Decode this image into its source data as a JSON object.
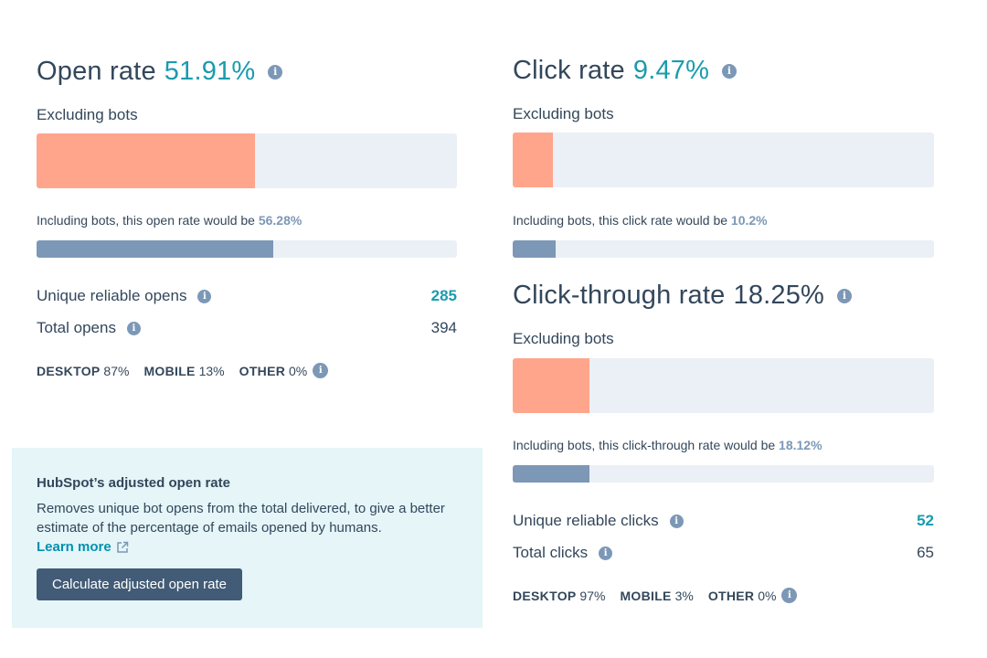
{
  "open_rate": {
    "title": "Open rate",
    "value": "51.91%",
    "fill_percent": 51.91,
    "excluding_label": "Excluding bots",
    "including_text": "Including bots, this open rate would be ",
    "including_value": "56.28%",
    "including_fill_percent": 56.28,
    "stats": [
      {
        "label": "Unique reliable opens",
        "value": "285",
        "accent": true
      },
      {
        "label": "Total opens",
        "value": "394",
        "accent": false
      }
    ],
    "devices": [
      {
        "name": "DESKTOP",
        "value": "87%"
      },
      {
        "name": "MOBILE",
        "value": "13%"
      },
      {
        "name": "OTHER",
        "value": "0%"
      }
    ]
  },
  "click_rate": {
    "title": "Click rate",
    "value": "9.47%",
    "fill_percent": 9.47,
    "excluding_label": "Excluding bots",
    "including_text": "Including bots, this click rate would be ",
    "including_value": "10.2%",
    "including_fill_percent": 10.2
  },
  "ctr": {
    "title": "Click-through rate",
    "value": "18.25%",
    "fill_percent": 18.25,
    "excluding_label": "Excluding bots",
    "including_text": "Including bots, this click-through rate would be ",
    "including_value": "18.12%",
    "including_fill_percent": 18.12,
    "stats": [
      {
        "label": "Unique reliable clicks",
        "value": "52",
        "accent": true
      },
      {
        "label": "Total clicks",
        "value": "65",
        "accent": false
      }
    ],
    "devices": [
      {
        "name": "DESKTOP",
        "value": "97%"
      },
      {
        "name": "MOBILE",
        "value": "3%"
      },
      {
        "name": "OTHER",
        "value": "0%"
      }
    ]
  },
  "callout": {
    "title": "HubSpot’s adjusted open rate",
    "body": "Removes unique bot opens from the total delivered, to give a better estimate of the percentage of emails opened by humans.",
    "learn_more": "Learn more",
    "button": "Calculate adjusted open rate"
  },
  "icons": {
    "info": "i"
  },
  "colors": {
    "accent": "#1a9bad",
    "bar_excluding": "#ffa58c",
    "bar_including": "#7c98b6",
    "bar_track": "#eaf0f6",
    "callout_bg": "#e5f5f8",
    "button_bg": "#425b76"
  }
}
